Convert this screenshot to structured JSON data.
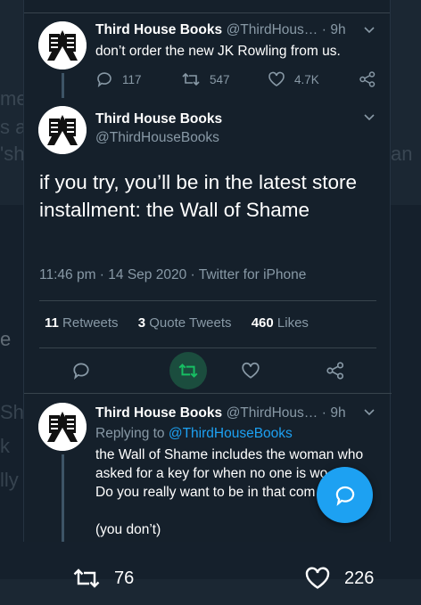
{
  "tweet1": {
    "name": "Third House Books",
    "handle": "@ThirdHous…",
    "sep": "·",
    "time": "9h",
    "text": "don’t order the new JK Rowling from us.",
    "replies": "117",
    "retweets": "547",
    "likes": "4.7K"
  },
  "main_tweet": {
    "name": "Third House Books",
    "handle": "@ThirdHouseBooks",
    "text": "if you try, you’ll be in the latest store installment: the Wall of Shame",
    "time": "11:46 pm",
    "date": "14 Sep 2020",
    "source": "Twitter for iPhone",
    "dot": "·",
    "retweets_count": "11",
    "retweets_label": "Retweets",
    "quotes_count": "3",
    "quotes_label": "Quote Tweets",
    "likes_count": "460",
    "likes_label": "Likes"
  },
  "reply_tweet": {
    "name": "Third House Books",
    "handle": "@ThirdHous…",
    "sep": "·",
    "time": "9h",
    "replying_prefix": "Replying to",
    "replying_to": "@ThirdHouseBooks",
    "line1": "the Wall of Shame includes the woman who",
    "line2": "asked for a key for when no one is wo…",
    "line3": "Do you really want to be in that com…",
    "line4": "(you don’t)"
  },
  "background": {
    "frag1": "me",
    "frag2": "s a",
    "frag3": "'sh",
    "frag4": "an",
    "frag5": "e",
    "frag6": "Sh",
    "frag7": "k",
    "frag8": "lly"
  },
  "bottom_bar": {
    "retweets": "76",
    "likes": "226"
  },
  "colors": {
    "accent": "#1da1f2",
    "retweet_green": "#17bf63",
    "background": "#15202b"
  },
  "icons": [
    "chevron-down-icon",
    "reply-icon",
    "retweet-icon",
    "like-icon",
    "share-icon",
    "compose-fab-icon"
  ]
}
